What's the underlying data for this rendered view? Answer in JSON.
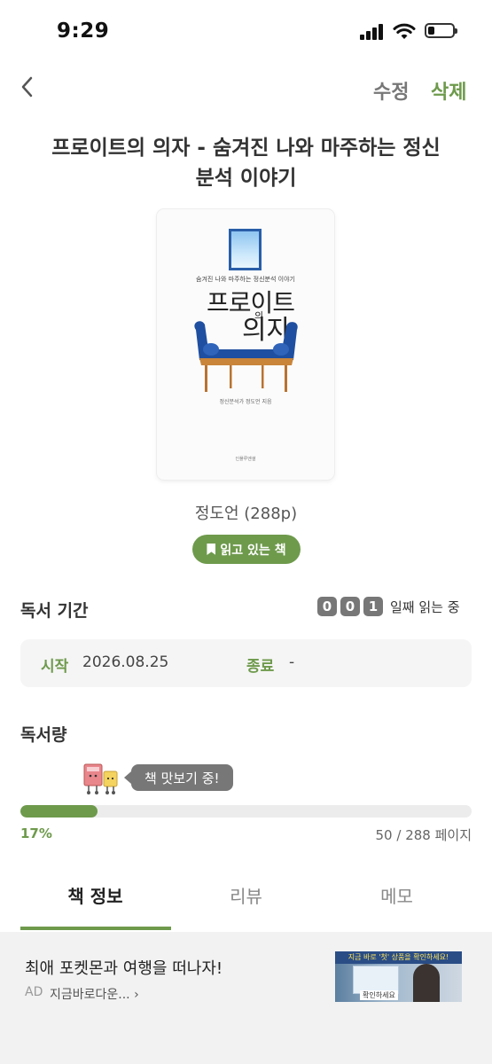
{
  "status_bar": {
    "time": "9:29"
  },
  "nav": {
    "edit_label": "수정",
    "delete_label": "삭제"
  },
  "book": {
    "title_line1": "프로이트의 의자 - 숨겨진 나와 마주하는 정신",
    "title_line2": "분석 이야기",
    "cover": {
      "subtitle": "숨겨진 나와 마주하는 정신분석 이야기",
      "title_a": "프로이트",
      "title_small": "의",
      "title_b": "의자",
      "author_line": "정신분석가 정도언 지음",
      "publisher": "인플루엔셜"
    },
    "author_pages": "정도언 (288p)",
    "status_badge": "읽고 있는 책"
  },
  "reading_period": {
    "heading": "독서 기간",
    "day_digits": [
      "0",
      "0",
      "1"
    ],
    "day_suffix": "일째 읽는 중",
    "start_label": "시작",
    "start_value": "2026.08.25",
    "end_label": "종료",
    "end_value": "-"
  },
  "reading_amount": {
    "heading": "독서량",
    "bubble_text": "책 맛보기 중!",
    "progress_fraction": 0.17,
    "percent_text": "17%",
    "pages_text": "50 / 288 페이지"
  },
  "tabs": [
    "책 정보",
    "리뷰",
    "메모"
  ],
  "active_tab": 0,
  "ad": {
    "title": "최애 포켓몬과 여행을 떠나자!",
    "label": "AD",
    "cta": "지금바로다운... ›",
    "thumb_banner": "지금 바로 '첫' 상품을 확인하세요!",
    "thumb_caption": "확인하세요"
  },
  "colors": {
    "accent": "#6e9a4c",
    "muted": "#777777",
    "background_ad": "#f2f2f2"
  },
  "icons": [
    "back-chevron-icon",
    "bookmark-icon",
    "book-mascot-icon",
    "cellular-signal-icon",
    "wifi-icon",
    "battery-icon"
  ]
}
